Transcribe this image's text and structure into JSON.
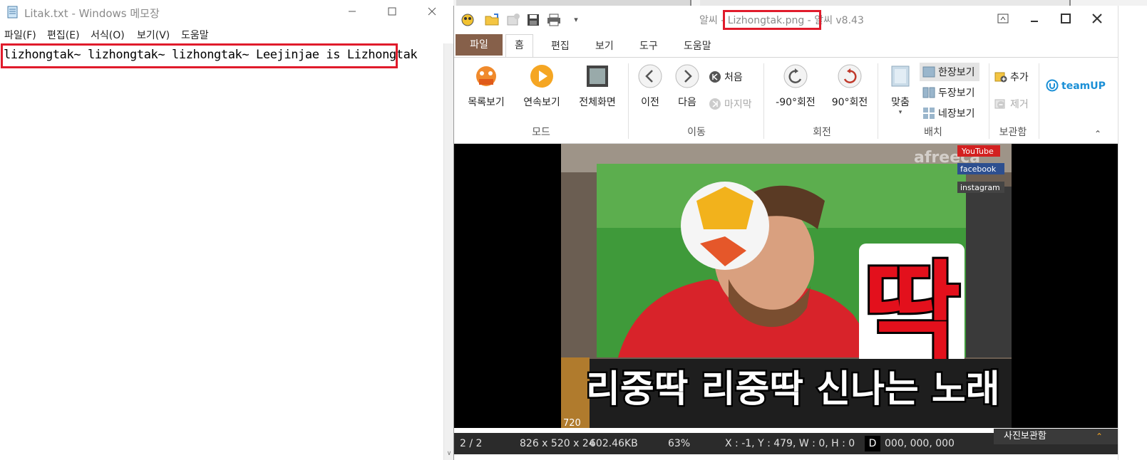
{
  "notepad": {
    "title": "Litak.txt - Windows 메모장",
    "menu": [
      "파일(F)",
      "편집(E)",
      "서식(O)",
      "보기(V)",
      "도움말"
    ],
    "content": "lizhongtak~ lizhongtak~ lizhongtak~ Leejinjae is Lizhongtak"
  },
  "honeyview": {
    "title_left": "알씨",
    "title_file": "- Lizhongtak.png -",
    "title_right": "알씨 v8.43",
    "tabs": [
      "파일",
      "홈",
      "편집",
      "보기",
      "도구",
      "도움말"
    ],
    "ribbon": {
      "mode": {
        "group": "모드",
        "buttons": [
          "목록보기",
          "연속보기",
          "전체화면"
        ]
      },
      "move": {
        "group": "이동",
        "prev": "이전",
        "next": "다음",
        "first": "처음",
        "last": "마지막"
      },
      "rotate": {
        "group": "회전",
        "left": "-90°회전",
        "right": "90°회전"
      },
      "layout": {
        "group": "배치",
        "fit": "맞춤",
        "single": "한장보기",
        "double": "두장보기",
        "quad": "네장보기"
      },
      "storage": {
        "group": "보관함",
        "add": "추가",
        "remove": "제거"
      },
      "teamup": "teamUP"
    },
    "image": {
      "big_char": "딱",
      "caption": "리중딱 리중딱 신나는 노래",
      "watermark": "afreeca",
      "social": [
        "YouTube",
        "facebook",
        "instagram"
      ],
      "corner_label": "720"
    },
    "status": {
      "page": "2 / 2",
      "dimensions": "826 x 520 x 24",
      "filesize": "602.46KB",
      "zoom": "63%",
      "coords": "X : -1, Y : 479, W : 0, H : 0",
      "d_label": "D",
      "rgb": "000, 000, 000",
      "album": "사진보관함"
    },
    "colors": {
      "accent": "#86604a",
      "highlight": "#e01b2b",
      "statusbar": "#2b2b2b"
    }
  }
}
